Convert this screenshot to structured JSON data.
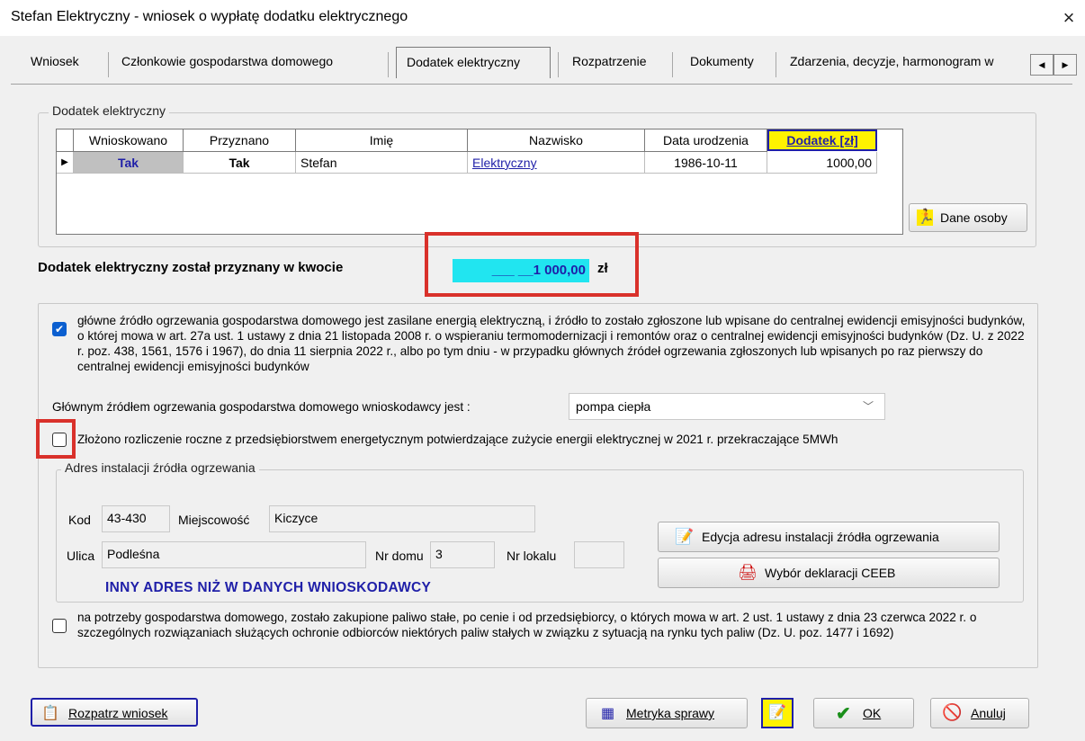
{
  "window": {
    "title": "Stefan Elektryczny - wniosek o wypłatę dodatku elektrycznego",
    "close": "×"
  },
  "tabs": [
    {
      "label": "Wniosek"
    },
    {
      "label": "Członkowie gospodarstwa domowego"
    },
    {
      "label": "Dodatek elektryczny"
    },
    {
      "label": "Rozpatrzenie"
    },
    {
      "label": "Dokumenty"
    },
    {
      "label": "Zdarzenia, decyzje, harmonogram w"
    }
  ],
  "tab_scroll": {
    "left": "◀",
    "right": "▶"
  },
  "dodatek_group": {
    "label": "Dodatek elektryczny",
    "columns": [
      "Wnioskowano",
      "Przyznano",
      "Imię",
      "Nazwisko",
      "Data urodzenia",
      "Dodatek [zł]"
    ],
    "row": {
      "wnioskowano": "Tak",
      "przyznano": "Tak",
      "imie": "Stefan",
      "nazwisko": "Elektryczny",
      "data_urodzenia": "1986-10-11",
      "dodatek": "1000,00"
    },
    "dane_osoby_btn": "Dane osoby"
  },
  "kwota": {
    "label": "Dodatek elektryczny został przyznany w kwocie",
    "value": "___ __1 000,00",
    "unit": "zł"
  },
  "heating": {
    "checkbox1_checked": true,
    "checkbox1_text": "główne źródło ogrzewania gospodarstwa domowego jest zasilane energią elektryczną, i źródło to zostało zgłoszone lub wpisane do centralnej ewidencji emisyjności budynków, o której mowa w art. 27a ust. 1 ustawy z dnia 21 listopada 2008 r. o wspieraniu termomodernizacji i remontów oraz o centralnej ewidencji emisyjności budynków (Dz. U. z 2022 r. poz. 438, 1561, 1576 i 1967), do dnia 11 sierpnia 2022 r., albo po tym dniu - w przypadku głównych źródeł ogrzewania zgłoszonych lub wpisanych po raz pierwszy do centralnej ewidencji emisyjności budynków",
    "source_label": "Głównym źródłem ogrzewania gospodarstwa domowego wnioskodawcy jest :",
    "source_value": "pompa ciepła",
    "checkbox2_checked": false,
    "checkbox2_text": "Złożono rozliczenie roczne z przedsiębiorstwem energetycznym potwierdzające zużycie energii elektrycznej w 2021 r. przekraczające 5MWh"
  },
  "adres": {
    "group_label": "Adres instalacji źródła ogrzewania",
    "kod_label": "Kod",
    "kod": "43-430",
    "miejscowosc_label": "Miejscowość",
    "miejscowosc": "Kiczyce",
    "ulica_label": "Ulica",
    "ulica": "Podleśna",
    "nr_domu_label": "Nr domu",
    "nr_domu": "3",
    "nr_lokalu_label": "Nr lokalu",
    "nr_lokalu": "",
    "inny_adres": "INNY ADRES NIŻ W DANYCH WNIOSKODAWCY",
    "edycja_btn": "Edycja adresu instalacji źródła ogrzewania",
    "wybor_btn": "Wybór deklaracji CEEB"
  },
  "paliwo": {
    "checked": false,
    "text": "na potrzeby gospodarstwa domowego, zostało zakupione paliwo stałe, po cenie i od przedsiębiorcy, o których mowa w art. 2 ust. 1 ustawy z dnia 23 czerwca 2022 r. o szczególnych rozwiązaniach służących ochronie odbiorców niektórych paliw stałych w związku z sytuacją na rynku tych paliw (Dz. U. poz. 1477 i 1692)"
  },
  "footer": {
    "rozpatrz": "Rozpatrz wniosek",
    "metryka": "Metryka sprawy",
    "ok": "OK",
    "anuluj": "Anuluj"
  },
  "colors": {
    "accent_blue": "#0b5fd0",
    "highlight_red": "#d9312b",
    "amount_bg": "#21e5f0",
    "link_blue": "#1f1fa8",
    "header_yellow": "#fff200"
  }
}
